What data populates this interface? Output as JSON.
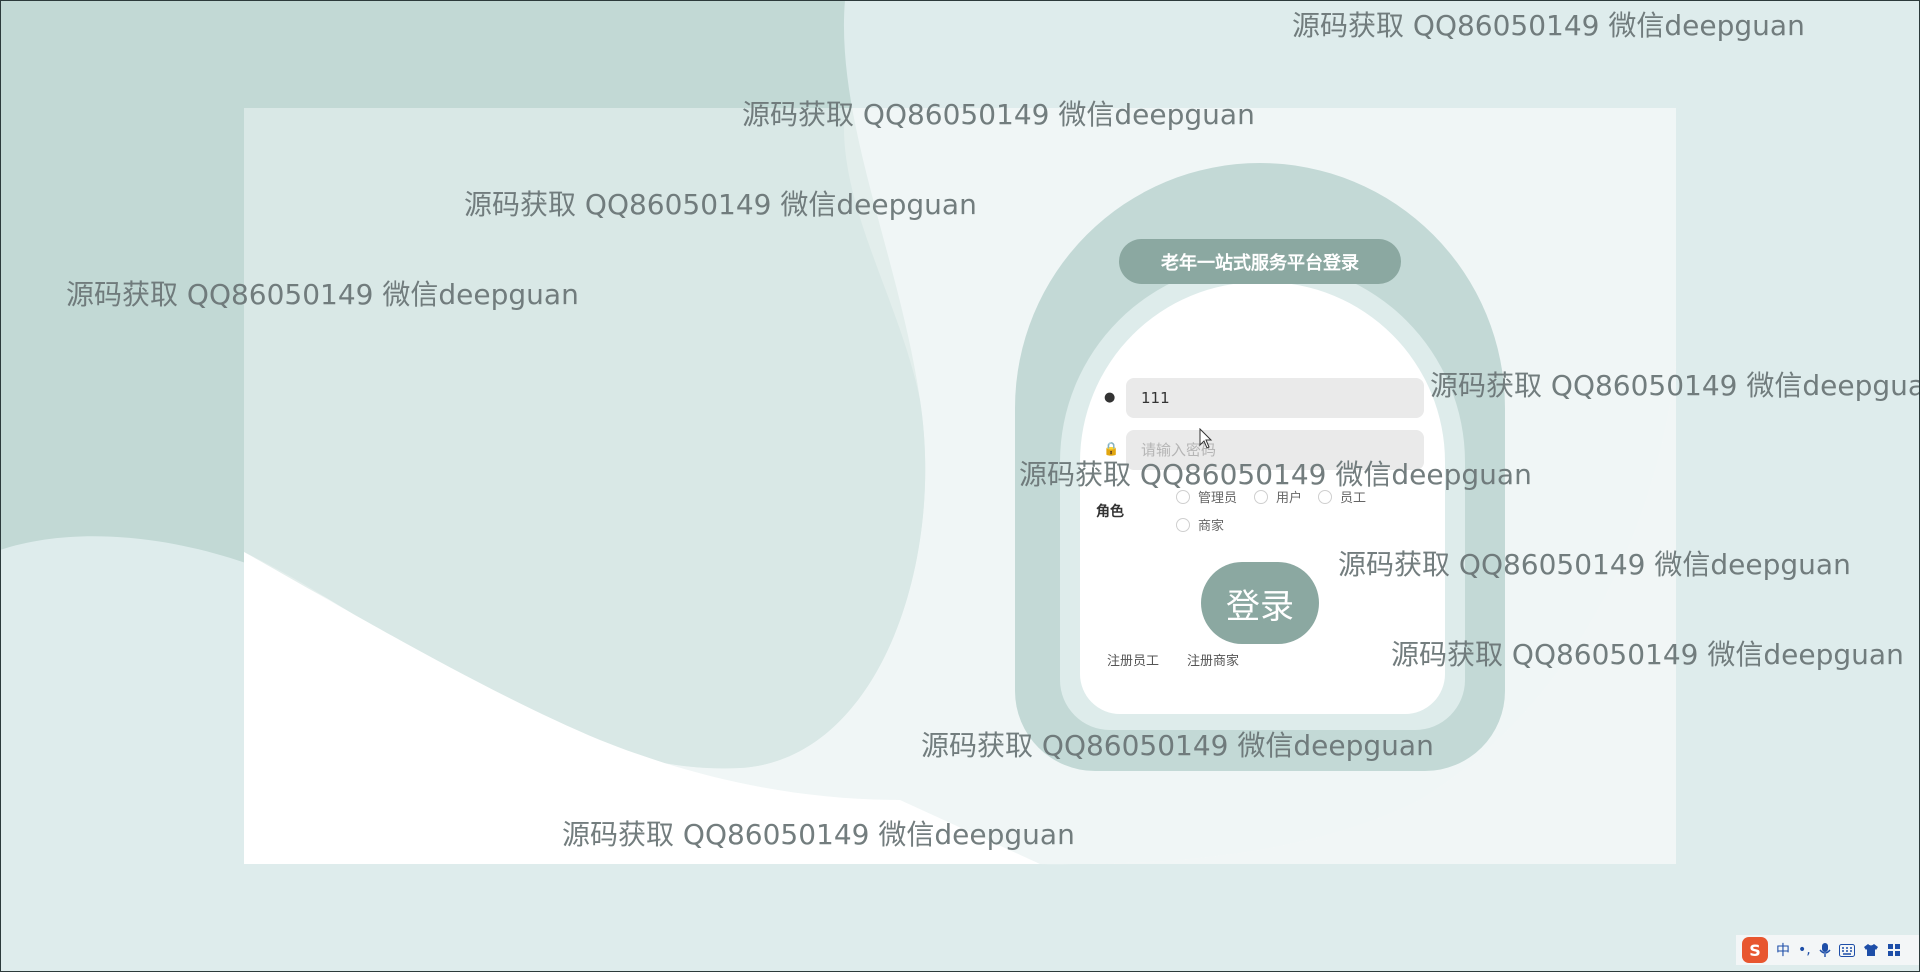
{
  "login": {
    "title": "老年一站式服务平台登录",
    "username_value": "111",
    "username_icon": "user-icon",
    "password_placeholder": "请输入密码",
    "password_icon": "lock-icon",
    "role_label": "角色",
    "roles": [
      "管理员",
      "用户",
      "员工",
      "商家"
    ],
    "login_button": "登录",
    "register_staff": "注册员工",
    "register_merchant": "注册商家"
  },
  "watermark_text": "源码获取 QQ86050149 微信deepguan",
  "tray": {
    "ime_logo": "S",
    "ime_lang": "中",
    "punct": "•,",
    "icons": [
      "mic-icon",
      "keyboard-icon",
      "shirt-icon",
      "grid-icon"
    ]
  },
  "colors": {
    "accent": "#8ba8a1",
    "background": "#deecec",
    "blob_dark": "#c2d9d5",
    "watermark": "#6c7778"
  }
}
